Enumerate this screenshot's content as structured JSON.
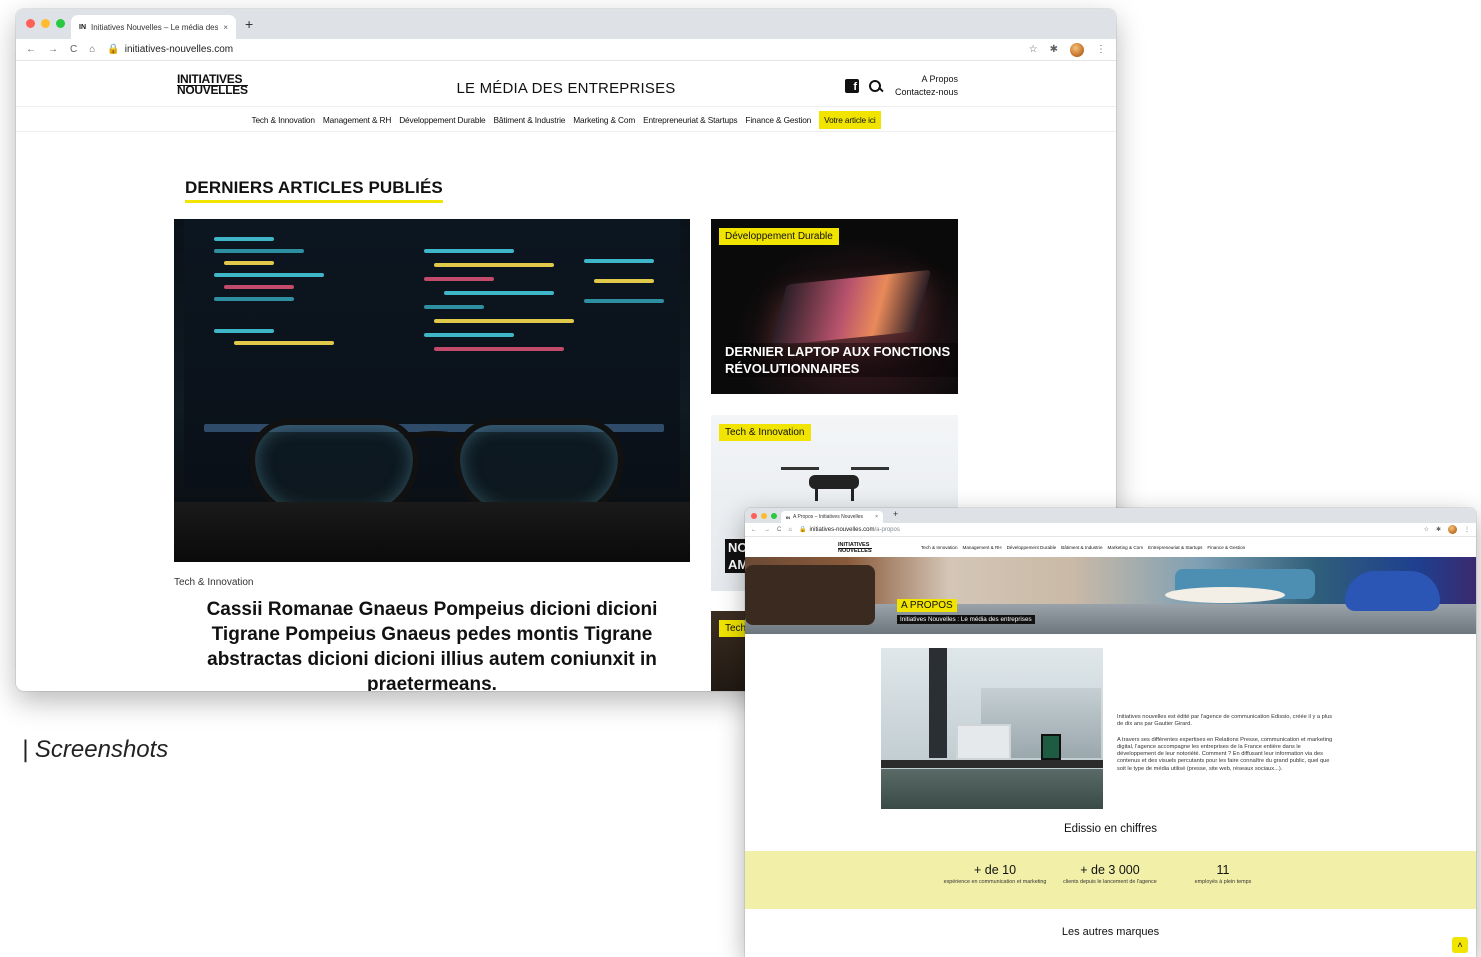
{
  "window1": {
    "tab": {
      "favicon": "IN",
      "title": "Initiatives Nouvelles – Le média des",
      "close": "×",
      "new_tab": "+"
    },
    "address_bar": {
      "back": "←",
      "forward": "→",
      "reload": "C",
      "home": "⌂",
      "lock": "🔒",
      "url": "initiatives-nouvelles.com",
      "star": "☆",
      "extensions": "✱",
      "menu": "⋮"
    },
    "site": {
      "logo_line1": "INITIATIVES",
      "logo_line2": "NOUVELLES",
      "tagline": "LE MÉDIA DES ENTREPRISES",
      "facebook_glyph": "f",
      "header_links": [
        "A Propos",
        "Contactez-nous"
      ],
      "nav": [
        "Tech & Innovation",
        "Management & RH",
        "Développement Durable",
        "Bâtiment & Industrie",
        "Marketing & Com",
        "Entrepreneuriat & Startups",
        "Finance & Gestion"
      ],
      "nav_cta": "Votre article ici",
      "section_title": "DERNIERS ARTICLES PUBLIÉS",
      "hero_category": "Tech & Innovation",
      "hero_title": "Cassii Romanae Gnaeus Pompeius dicioni dicioni Tigrane Pompeius Gnaeus pedes montis Tigrane abstractas dicioni dicioni illius autem coniunxit in praetermeans.",
      "cards": [
        {
          "badge": "Développement Durable",
          "title": "DERNIER LAPTOP AUX FONCTIONS RÉVOLUTIONNAIRES"
        },
        {
          "badge": "Tech & Innovation",
          "title_peek": "NO\nAM"
        },
        {
          "badge": "Tech"
        }
      ]
    }
  },
  "window2": {
    "tab": {
      "favicon": "IN",
      "title": "A Propos – Initiatives Nouvelles",
      "close": "×",
      "new_tab": "+"
    },
    "address_bar": {
      "back": "←",
      "forward": "→",
      "reload": "C",
      "home": "⌂",
      "lock": "🔒",
      "url_host": "initiatives-nouvelles.com",
      "url_path": "/a-propos",
      "star": "☆",
      "extensions": "✱",
      "menu": "⋮"
    },
    "site": {
      "logo_line1": "INITIATIVES",
      "logo_line2": "NOUVELLES",
      "nav": [
        "Tech & Innovation",
        "Management & RH",
        "Développement Durable",
        "Bâtiment & Industrie",
        "Marketing & Com",
        "Entrepreneuriat & Startups",
        "Finance & Gestion"
      ],
      "hero_badge": "A PROPOS",
      "hero_subtitle": "Initiatives Nouvelles : Le média des entreprises",
      "intro_p1": "Initiatives nouvelles est édité par l'agence de communication Edissio, créée il y a plus de dix ans par Gautier Girard.",
      "intro_p2": "A travers ses différentes expertises en Relations Presse, communication et marketing digital, l'agence accompagne les entreprises de la France entière dans le développement de leur notoriété. Comment ? En diffusant leur information via des contenus et des visuels percutants pour les faire connaître du grand public, quel que soit le type de média utilisé (presse, site web, réseaux sociaux...).",
      "stats_title": "Edissio en chiffres",
      "stats": [
        {
          "value": "+ de 10",
          "label": "expérience en communication et marketing"
        },
        {
          "value": "+ de 3 000",
          "label": "clients depuis le lancement de l'agence"
        },
        {
          "value": "11",
          "label": "employés à plein temps"
        }
      ],
      "brands_title": "Les autres marques",
      "scroll_top": "˄"
    }
  },
  "caption": "| Screenshots",
  "colors": {
    "accent_yellow": "#f0e400",
    "band_yellow": "#f2f0a8",
    "text_dark": "#111111"
  }
}
